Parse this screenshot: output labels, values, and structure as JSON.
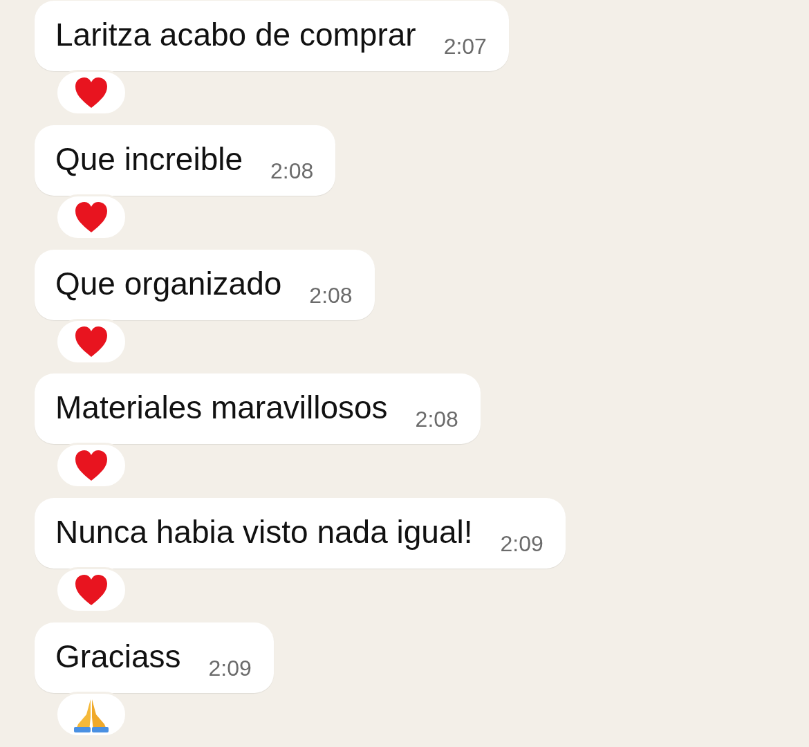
{
  "messages": [
    {
      "text": "Laritza acabo de comprar",
      "time": "2:07",
      "reaction": {
        "kind": "heart"
      }
    },
    {
      "text": "Que increible",
      "time": "2:08",
      "reaction": {
        "kind": "heart"
      }
    },
    {
      "text": "Que organizado",
      "time": "2:08",
      "reaction": {
        "kind": "heart"
      }
    },
    {
      "text": "Materiales maravillosos",
      "time": "2:08",
      "reaction": {
        "kind": "heart"
      }
    },
    {
      "text": "Nunca habia visto nada igual!",
      "time": "2:09",
      "reaction": {
        "kind": "heart"
      }
    },
    {
      "text": "Graciass",
      "time": "2:09",
      "reaction": {
        "kind": "pray"
      }
    }
  ]
}
